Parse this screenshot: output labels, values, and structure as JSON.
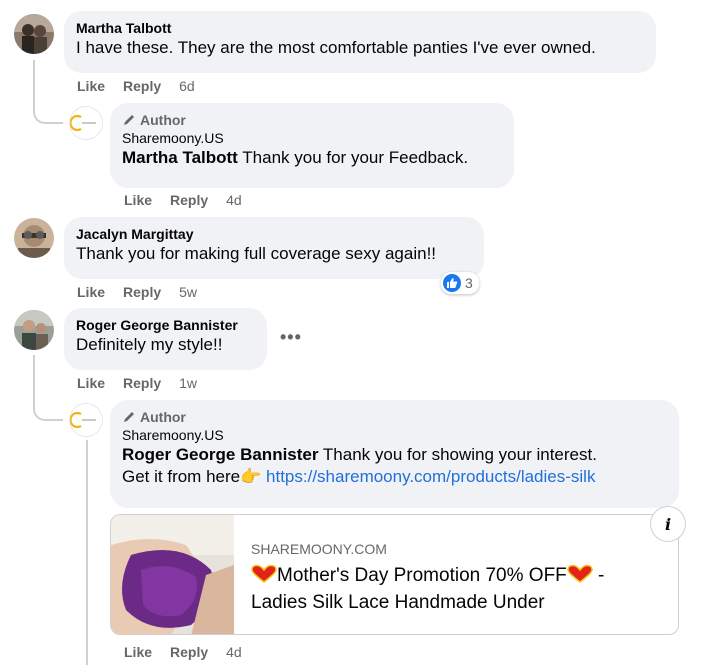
{
  "comments": [
    {
      "author": "Martha Talbott",
      "text": "I have these. They are the most comfortable panties I've ever owned.",
      "actions": {
        "like": "Like",
        "reply": "Reply",
        "time": "6d"
      },
      "reply": {
        "badge": "Author",
        "page_name": "Sharemoony.US",
        "mention": "Martha Talbott",
        "text": " Thank you for your Feedback.",
        "actions": {
          "like": "Like",
          "reply": "Reply",
          "time": "4d"
        }
      }
    },
    {
      "author": "Jacalyn Margittay",
      "text": "Thank you for making full coverage sexy again!!",
      "actions": {
        "like": "Like",
        "reply": "Reply",
        "time": "5w"
      },
      "reactions": {
        "icon": "like-icon",
        "count": "3"
      }
    },
    {
      "author": "Roger George Bannister",
      "text": "Definitely my style!!",
      "more": "•••",
      "actions": {
        "like": "Like",
        "reply": "Reply",
        "time": "1w"
      },
      "reply": {
        "badge": "Author",
        "page_name": "Sharemoony.US",
        "mention": "Roger George Bannister",
        "text": " Thank you for showing your interest.",
        "text2": "Get it from here",
        "emoji": "👉",
        "link": "https://sharemoony.com/products/ladies-silk",
        "actions": {
          "like": "Like",
          "reply": "Reply",
          "time": "4d"
        },
        "card": {
          "domain": "SHAREMOONY.COM",
          "title_line1_pre": "",
          "title_line1_text": "Mother's Day Promotion 70% OFF",
          "title_line1_post": " -",
          "title_line2": "Ladies Silk Lace Handmade Under",
          "info": "i"
        }
      }
    }
  ],
  "colors": {
    "bubble": "#f0f2f5",
    "secondary_text": "#65676b",
    "link": "#216fdb",
    "like_blue": "#1877f2"
  }
}
